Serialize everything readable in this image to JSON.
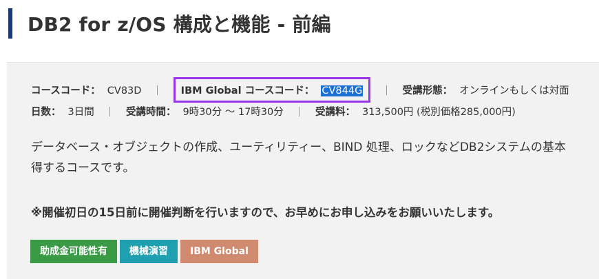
{
  "page": {
    "title": "DB2 for z/OS 構成と機能 - 前編"
  },
  "course_info": {
    "course_code_label": "コースコード：",
    "course_code": "CV83D",
    "ibm_code_label": "IBM Global コースコード：",
    "ibm_code": "CV844G",
    "format_label": "受講形態：",
    "format": "オンラインもしくは対面",
    "days_label": "日数：",
    "days": "3日間",
    "time_label": "受講時間：",
    "time": "9時30分 〜 17時30分",
    "fee_label": "受講料：",
    "fee": "313,500円 (税別価格285,000円)"
  },
  "description": {
    "line1": "データベース・オブジェクトの作成、ユーティリティー、BIND 処理、ロックなどDB2システムの基本",
    "line2": "得するコースです。"
  },
  "notice": "※開催初日の15日前に開催判断を行いますので、お早めにお申し込みをお願いいたします。",
  "tags": [
    {
      "label": "助成金可能性有",
      "color": "#3a9a46"
    },
    {
      "label": "機械演習",
      "color": "#1fa0b0"
    },
    {
      "label": "IBM Global",
      "color": "#d08a70"
    }
  ],
  "colors": {
    "title_bar": "#1a3a7a",
    "highlight_box": "#9b35ea",
    "selection": "#1a6fd6",
    "panel_bg": "#f2f2f2"
  }
}
